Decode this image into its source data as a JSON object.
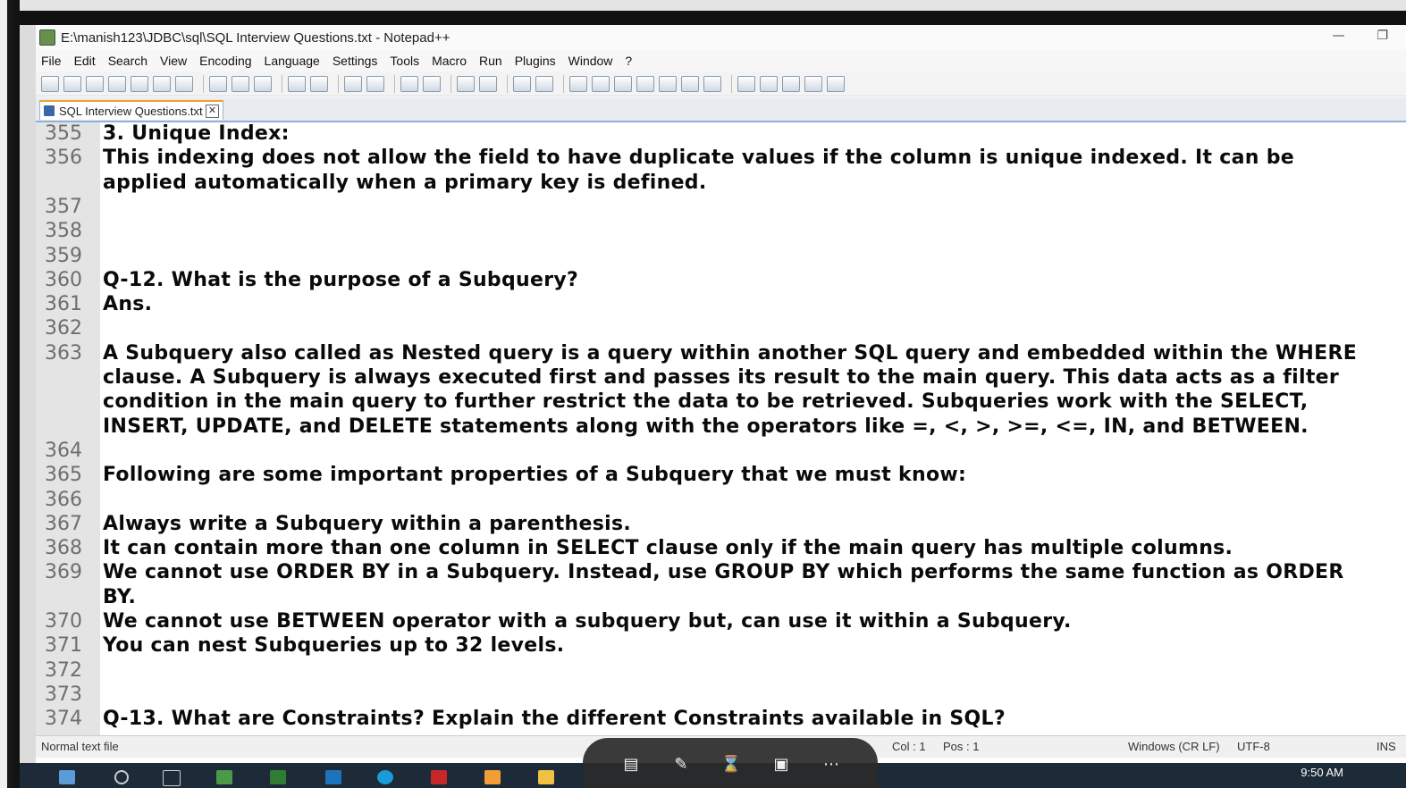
{
  "window": {
    "title": "E:\\manish123\\JDBC\\sql\\SQL Interview Questions.txt - Notepad++"
  },
  "menu": [
    "File",
    "Edit",
    "Search",
    "View",
    "Encoding",
    "Language",
    "Settings",
    "Tools",
    "Macro",
    "Run",
    "Plugins",
    "Window",
    "?"
  ],
  "tab": {
    "label": "SQL Interview Questions.txt"
  },
  "editor": {
    "lines": [
      {
        "n": "355",
        "text": "3. Unique Index:"
      },
      {
        "n": "356",
        "text": "This indexing does not allow the field to have duplicate values if the column is unique indexed. It can be"
      },
      {
        "n": "",
        "text": "applied automatically when a primary key is defined."
      },
      {
        "n": "357",
        "text": ""
      },
      {
        "n": "358",
        "text": ""
      },
      {
        "n": "359",
        "text": ""
      },
      {
        "n": "360",
        "text": "Q-12. What is the purpose of a Subquery?"
      },
      {
        "n": "361",
        "text": "Ans."
      },
      {
        "n": "362",
        "text": ""
      },
      {
        "n": "363",
        "text": "A Subquery also called as Nested query is a query within another SQL query and embedded within the WHERE"
      },
      {
        "n": "",
        "text": "clause. A Subquery is always executed first and passes its result to the main query. This data acts as a filter"
      },
      {
        "n": "",
        "text": "condition in the main query to further restrict the data to be retrieved. Subqueries work with the SELECT,"
      },
      {
        "n": "",
        "text": "INSERT, UPDATE, and DELETE statements along with the operators like =, <, >, >=, <=, IN, and BETWEEN."
      },
      {
        "n": "364",
        "text": ""
      },
      {
        "n": "365",
        "text": "Following are some important properties of a Subquery that we must know:"
      },
      {
        "n": "366",
        "text": ""
      },
      {
        "n": "367",
        "text": "Always write a Subquery within a parenthesis."
      },
      {
        "n": "368",
        "text": "It can contain more than one column in SELECT clause only if the main query has multiple columns."
      },
      {
        "n": "369",
        "text": "We cannot use ORDER BY in a Subquery. Instead, use GROUP BY which performs the same function as ORDER"
      },
      {
        "n": "",
        "text": "BY."
      },
      {
        "n": "370",
        "text": "We cannot use BETWEEN operator with a subquery but, can use it within a Subquery."
      },
      {
        "n": "371",
        "text": "You can nest Subqueries up to 32 levels."
      },
      {
        "n": "372",
        "text": ""
      },
      {
        "n": "373",
        "text": ""
      },
      {
        "n": "374",
        "text": "Q-13. What are Constraints? Explain the different Constraints available in SQL?"
      }
    ]
  },
  "status": {
    "file_type": "Normal text file",
    "col": "Col : 1",
    "pos": "Pos : 1",
    "eol": "Windows (CR LF)",
    "encoding": "UTF-8",
    "mode": "INS"
  },
  "taskbar": {
    "time": "9:50 AM"
  }
}
